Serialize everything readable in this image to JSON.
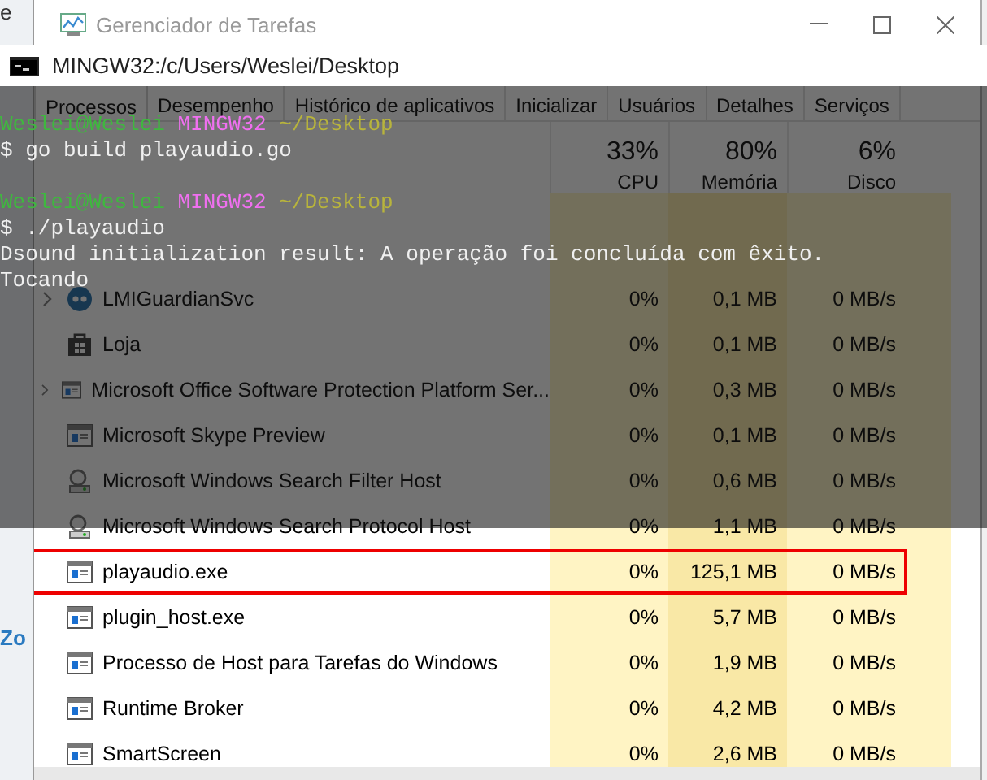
{
  "background_window": {
    "texts": [
      "e",
      "Zo"
    ]
  },
  "task_manager": {
    "title": "Gerenciador de Tarefas",
    "tabs": [
      {
        "label": "Processos",
        "selected": true
      },
      {
        "label": "Desempenho",
        "selected": false
      },
      {
        "label": "Histórico de aplicativos",
        "selected": false
      },
      {
        "label": "Inicializar",
        "selected": false
      },
      {
        "label": "Usuários",
        "selected": false
      },
      {
        "label": "Detalhes",
        "selected": false
      },
      {
        "label": "Serviços",
        "selected": false
      }
    ],
    "columns": [
      {
        "percent": "33%",
        "label": "CPU"
      },
      {
        "percent": "80%",
        "label": "Memória"
      },
      {
        "percent": "6%",
        "label": "Disco"
      }
    ],
    "rows": [
      {
        "name": "LMIGuardianSvc",
        "kind": "dot",
        "expandable": true,
        "highlighted": false,
        "cpu": "0%",
        "memory": "0,1 MB",
        "disk": "0 MB/s"
      },
      {
        "name": "Loja",
        "kind": "store",
        "expandable": false,
        "highlighted": false,
        "cpu": "0%",
        "memory": "0,1 MB",
        "disk": "0 MB/s"
      },
      {
        "name": "Microsoft Office Software Protection Platform Ser...",
        "kind": "app",
        "expandable": true,
        "highlighted": false,
        "cpu": "0%",
        "memory": "0,3 MB",
        "disk": "0 MB/s"
      },
      {
        "name": "Microsoft Skype Preview",
        "kind": "app",
        "expandable": false,
        "highlighted": false,
        "cpu": "0%",
        "memory": "0,1 MB",
        "disk": "0 MB/s"
      },
      {
        "name": "Microsoft Windows Search Filter Host",
        "kind": "search",
        "expandable": false,
        "highlighted": false,
        "cpu": "0%",
        "memory": "0,6 MB",
        "disk": "0 MB/s"
      },
      {
        "name": "Microsoft Windows Search Protocol Host",
        "kind": "search",
        "expandable": false,
        "highlighted": false,
        "cpu": "0%",
        "memory": "1,1 MB",
        "disk": "0 MB/s"
      },
      {
        "name": "playaudio.exe",
        "kind": "app",
        "expandable": false,
        "highlighted": true,
        "cpu": "0%",
        "memory": "125,1 MB",
        "disk": "0 MB/s"
      },
      {
        "name": "plugin_host.exe",
        "kind": "app",
        "expandable": false,
        "highlighted": false,
        "cpu": "0%",
        "memory": "5,7 MB",
        "disk": "0 MB/s"
      },
      {
        "name": "Processo de Host para Tarefas do Windows",
        "kind": "app",
        "expandable": false,
        "highlighted": false,
        "cpu": "0%",
        "memory": "1,9 MB",
        "disk": "0 MB/s"
      },
      {
        "name": "Runtime Broker",
        "kind": "app",
        "expandable": false,
        "highlighted": false,
        "cpu": "0%",
        "memory": "4,2 MB",
        "disk": "0 MB/s"
      },
      {
        "name": "SmartScreen",
        "kind": "app",
        "expandable": false,
        "highlighted": false,
        "cpu": "0%",
        "memory": "2,6 MB",
        "disk": "0 MB/s"
      }
    ]
  },
  "terminal": {
    "title": "MINGW32:/c/Users/Weslei/Desktop",
    "lines": [
      {
        "kind": "text",
        "segments": [
          {
            "text": "Weslei@Weslei",
            "color": "#3fb83f"
          },
          {
            "text": "MINGW32",
            "color": "#f070f0"
          },
          {
            "text": "~/Desktop",
            "color": "#b8b43c"
          }
        ]
      },
      {
        "kind": "text",
        "segments": [
          {
            "text": "$ go build playaudio.go",
            "color": "#f0f0f0"
          }
        ]
      },
      {
        "kind": "blank"
      },
      {
        "kind": "text",
        "segments": [
          {
            "text": "Weslei@Weslei",
            "color": "#3fb83f"
          },
          {
            "text": "MINGW32",
            "color": "#f070f0"
          },
          {
            "text": "~/Desktop",
            "color": "#b8b43c"
          }
        ]
      },
      {
        "kind": "text",
        "segments": [
          {
            "text": "$ ./playaudio",
            "color": "#f0f0f0"
          }
        ]
      },
      {
        "kind": "text",
        "segments": [
          {
            "text": "Dsound initialization result: A operação foi concluída com êxito.",
            "color": "#f0f0f0"
          }
        ]
      },
      {
        "kind": "text",
        "segments": [
          {
            "text": "Tocando",
            "color": "#f0f0f0"
          }
        ]
      }
    ]
  }
}
